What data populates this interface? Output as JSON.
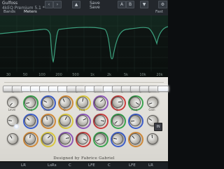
{
  "brand": {
    "line1": "Gulfoss",
    "line2": "4kEQ Premium 5.1 *"
  },
  "toolbar": {
    "save_label": "Save",
    "save_as_label": "Save",
    "a_label": "A",
    "b_label": "B",
    "compare_label": "Comp",
    "nav_back": "‹",
    "nav_forward": "›",
    "nav_up": "▲",
    "nav_down": "▼"
  },
  "tabs": {
    "bands": "Bands",
    "meters": "Meters",
    "fast": "Fast"
  },
  "eq": {
    "freq_labels": [
      "30",
      "50",
      "100",
      "200",
      "500",
      "1k",
      "2k",
      "5k",
      "10k",
      "20k"
    ],
    "db_labels": [
      "+12",
      "+6",
      "0",
      "-6",
      "-12",
      "-18"
    ]
  },
  "panel": {
    "credit": "Designed by Fabrice Gabriel",
    "knob_labels": [
      "Level",
      "Freq",
      "Gain",
      "Q",
      "Freq",
      "Gain",
      "Q",
      "Freq",
      "Gain",
      "Q",
      "Freq",
      "Gain",
      "Q",
      "Freq",
      "Gain",
      "Q",
      "Output"
    ],
    "switch_states": [
      0,
      0,
      1,
      1,
      1,
      1,
      1,
      0,
      0,
      1,
      0,
      1,
      0,
      0,
      0,
      0,
      0,
      1
    ],
    "in_button": "IN"
  },
  "bottom": {
    "items": [
      "LR",
      "LsRs",
      "C",
      "LFE",
      "C",
      "LFE",
      "LR"
    ]
  },
  "colors": {
    "curve": "#2f8f6b",
    "band_red": "#c83e3e",
    "band_green": "#3aa34e",
    "band_blue": "#3d5ecb",
    "band_orange": "#d08a3a",
    "band_yellow": "#d9c63d",
    "band_purple": "#8d58b8"
  }
}
